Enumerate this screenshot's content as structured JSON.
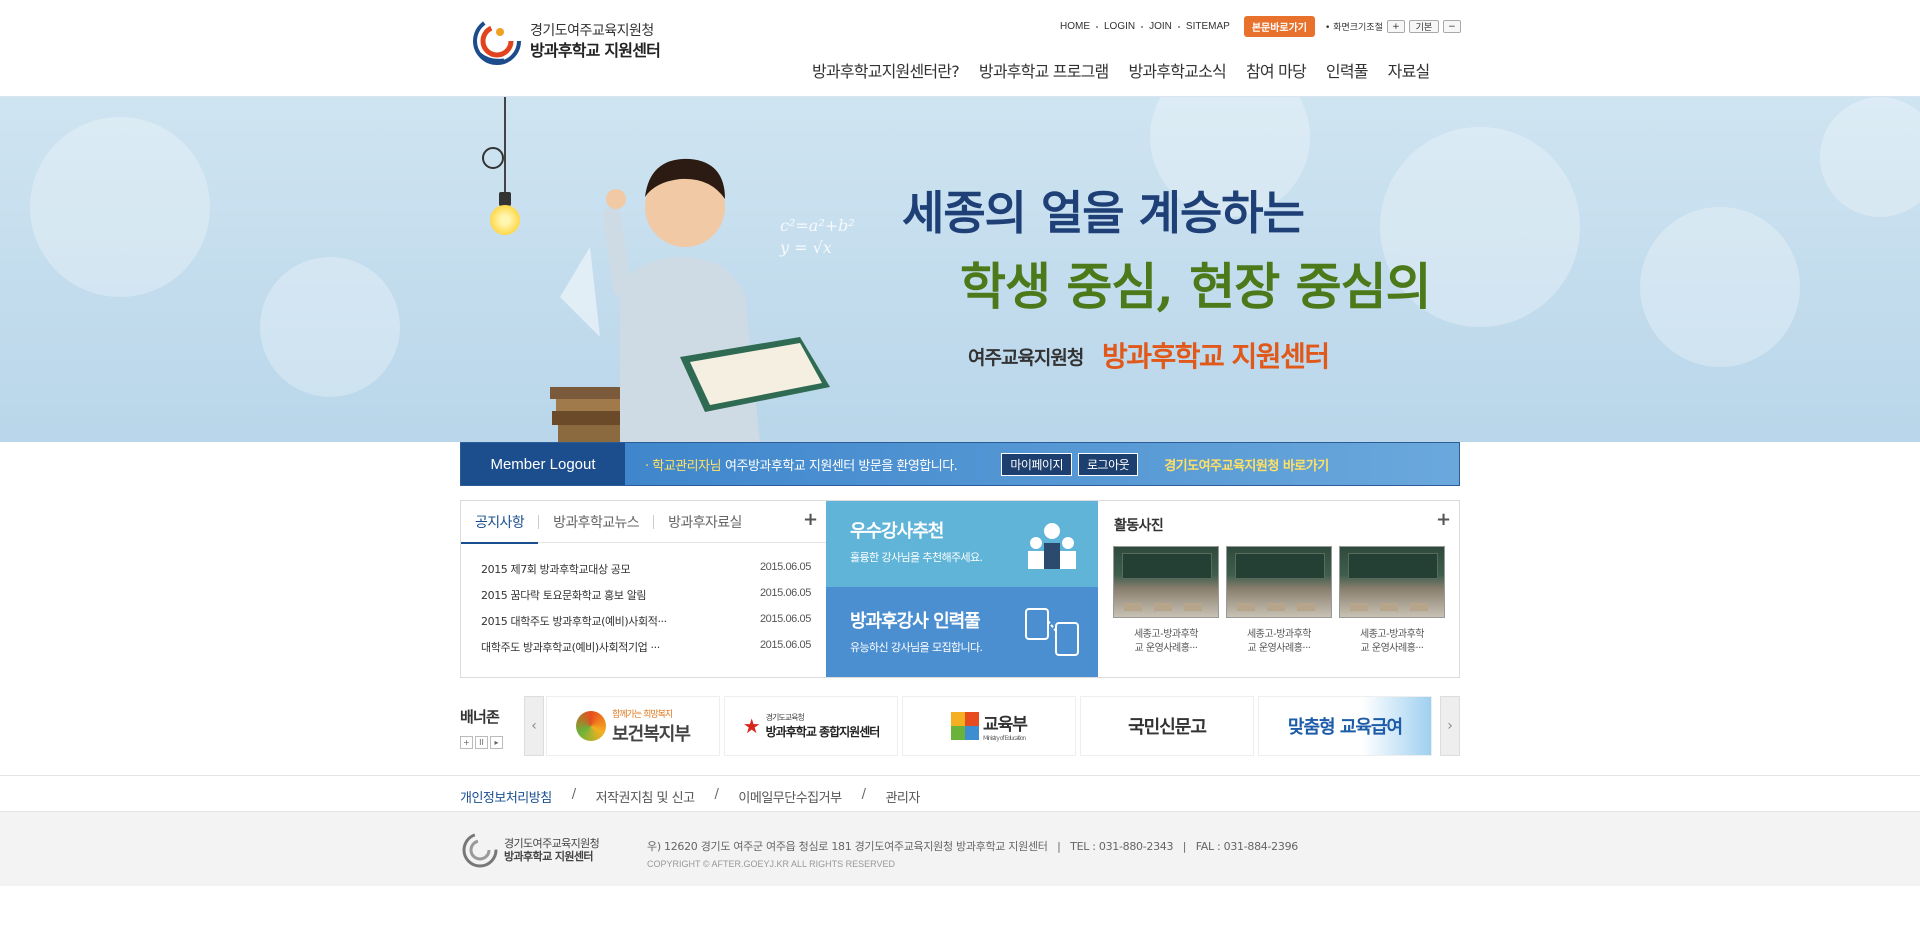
{
  "header": {
    "logo_line1": "경기도여주교육지원청",
    "logo_line2": "방과후학교 지원센터",
    "util_links": [
      "HOME",
      "LOGIN",
      "JOIN",
      "SITEMAP"
    ],
    "skip_button": "본문바로가기",
    "font_size_label": "화면크기조절",
    "font_size_buttons": [
      "+",
      "기본",
      "−"
    ],
    "gnb": [
      "방과후학교지원센터란?",
      "방과후학교 프로그램",
      "방과후학교소식",
      "참여 마당",
      "인력풀",
      "자료실"
    ]
  },
  "hero": {
    "line1": "세종의 얼을 계승하는",
    "line2": "학생 중심, 현장 중심의",
    "line3a": "여주교육지원청",
    "line3b": "방과후학교 지원센터"
  },
  "member": {
    "title": "Member Logout",
    "user": "· 학교관리자님",
    "welcome": "여주방과후학교 지원센터 방문을 환영합니다.",
    "mypage": "마이페이지",
    "logout": "로그아웃",
    "goto": "경기도여주교육지원청 바로가기"
  },
  "notice": {
    "tabs": [
      "공지사항",
      "방과후학교뉴스",
      "방과후자료실"
    ],
    "more": "+",
    "items": [
      {
        "title": "2015 제7회 방과후학교대상 공모",
        "date": "2015.06.05"
      },
      {
        "title": "2015 꿈다락 토요문화학교 홍보 알림",
        "date": "2015.06.05"
      },
      {
        "title": "2015 대학주도 방과후학교(예비)사회적···",
        "date": "2015.06.05"
      },
      {
        "title": "대학주도 방과후학교(예비)사회적기업 ···",
        "date": "2015.06.05"
      }
    ]
  },
  "promo": {
    "p1_title": "우수강사추천",
    "p1_sub": "훌륭한 강사님을 추천해주세요.",
    "p2_title": "방과후강사 인력풀",
    "p2_sub": "유능하신 강사님을 모집합니다."
  },
  "photos": {
    "title": "활동사진",
    "more": "+",
    "items": [
      {
        "caption1": "세종고-방과후학",
        "caption2": "교 운영사례홍···"
      },
      {
        "caption1": "세종고-방과후학",
        "caption2": "교 운영사례홍···"
      },
      {
        "caption1": "세종고-방과후학",
        "caption2": "교 운영사례홍···"
      }
    ]
  },
  "banner_zone": {
    "label": "배너존",
    "controls": [
      "+",
      "II",
      "▸"
    ],
    "prev": "‹",
    "next": "›",
    "items": [
      "보건복지부",
      "방과후학교 종합지원센터",
      "교육부",
      "국민신문고",
      "맞춤형 교육급여"
    ],
    "item2_top": "경기도교육청",
    "item3_sub": "Ministry of Education",
    "item1_slogan": "함께가는 희망복지"
  },
  "footer_links": [
    "개인정보처리방침",
    "저작권지침 및 신고",
    "이메일무단수집거부",
    "관리자"
  ],
  "footer": {
    "logo_line1": "경기도여주교육지원청",
    "logo_line2": "방과후학교 지원센터",
    "address": "우) 12620 경기도 여주군 여주읍 청심로 181 경기도여주교육지원청 방과후학교 지원센터   |   TEL : 031-880-2343   |   FAL : 031-884-2396",
    "copyright": "COPYRIGHT © AFTER.GOEYJ.KR ALL RIGHTS RESERVED"
  },
  "colors": {
    "brand_blue": "#1c4e8d",
    "accent_orange": "#e8722b",
    "hero_green": "#4c7a1b",
    "hero_orange": "#e0581a"
  }
}
